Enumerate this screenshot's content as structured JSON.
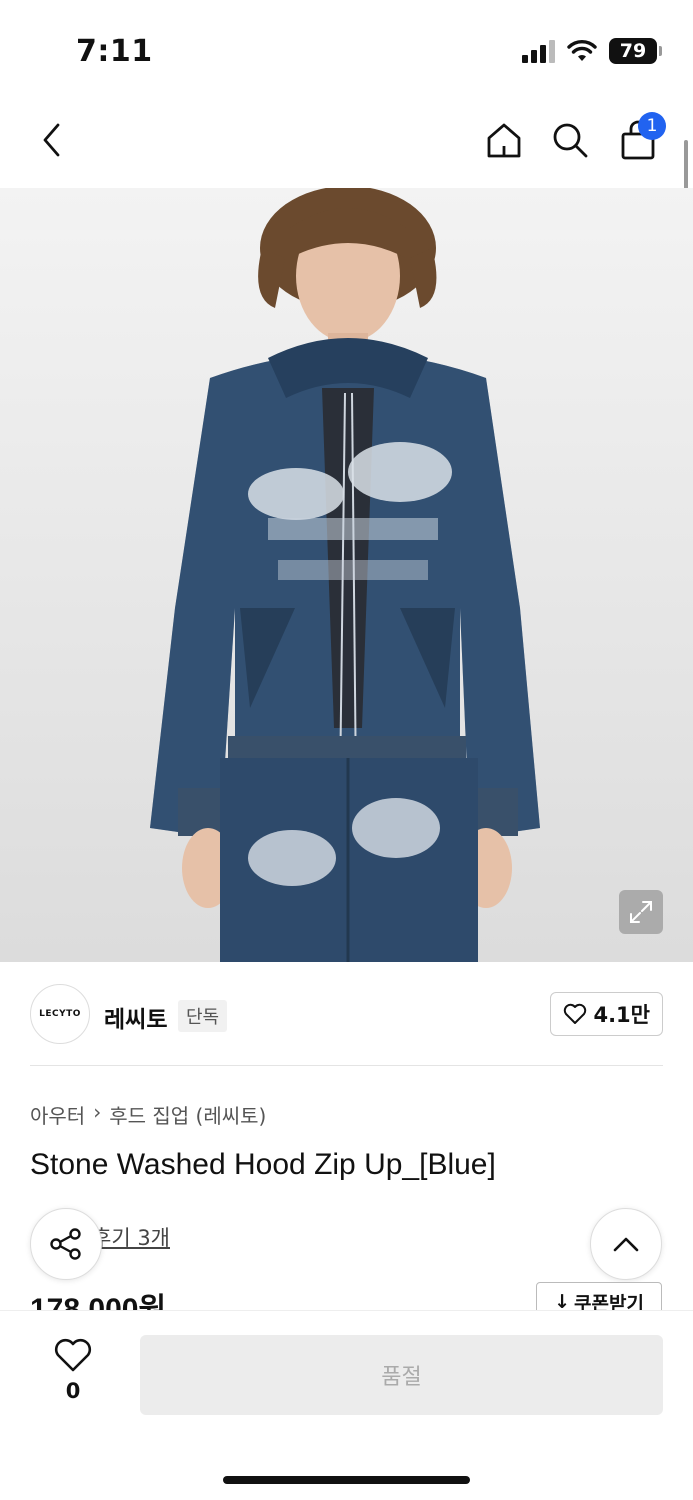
{
  "status_bar": {
    "time": "7:11",
    "battery": "79"
  },
  "nav": {
    "cart_count": "1",
    "icons": [
      "back-icon",
      "home-icon",
      "search-icon",
      "shopping-bag-icon"
    ]
  },
  "brand": {
    "logo_text": "LECYTO",
    "name": "레씨토",
    "badge": "단독",
    "like_count": "4.1만"
  },
  "product": {
    "breadcrumb": [
      "아우터",
      "후드 집업 (레씨토)"
    ],
    "title": "Stone Washed Hood Zip Up_[Blue]",
    "review_link": "후기 3개",
    "price": "178,000원",
    "coupon_label": "쿠폰받기"
  },
  "bottom_bar": {
    "wish_count": "0",
    "soldout_label": "품절"
  },
  "colors": {
    "accent": "#2163f0",
    "soldout_bg": "#ececec",
    "denim": "#2e4a6b"
  }
}
